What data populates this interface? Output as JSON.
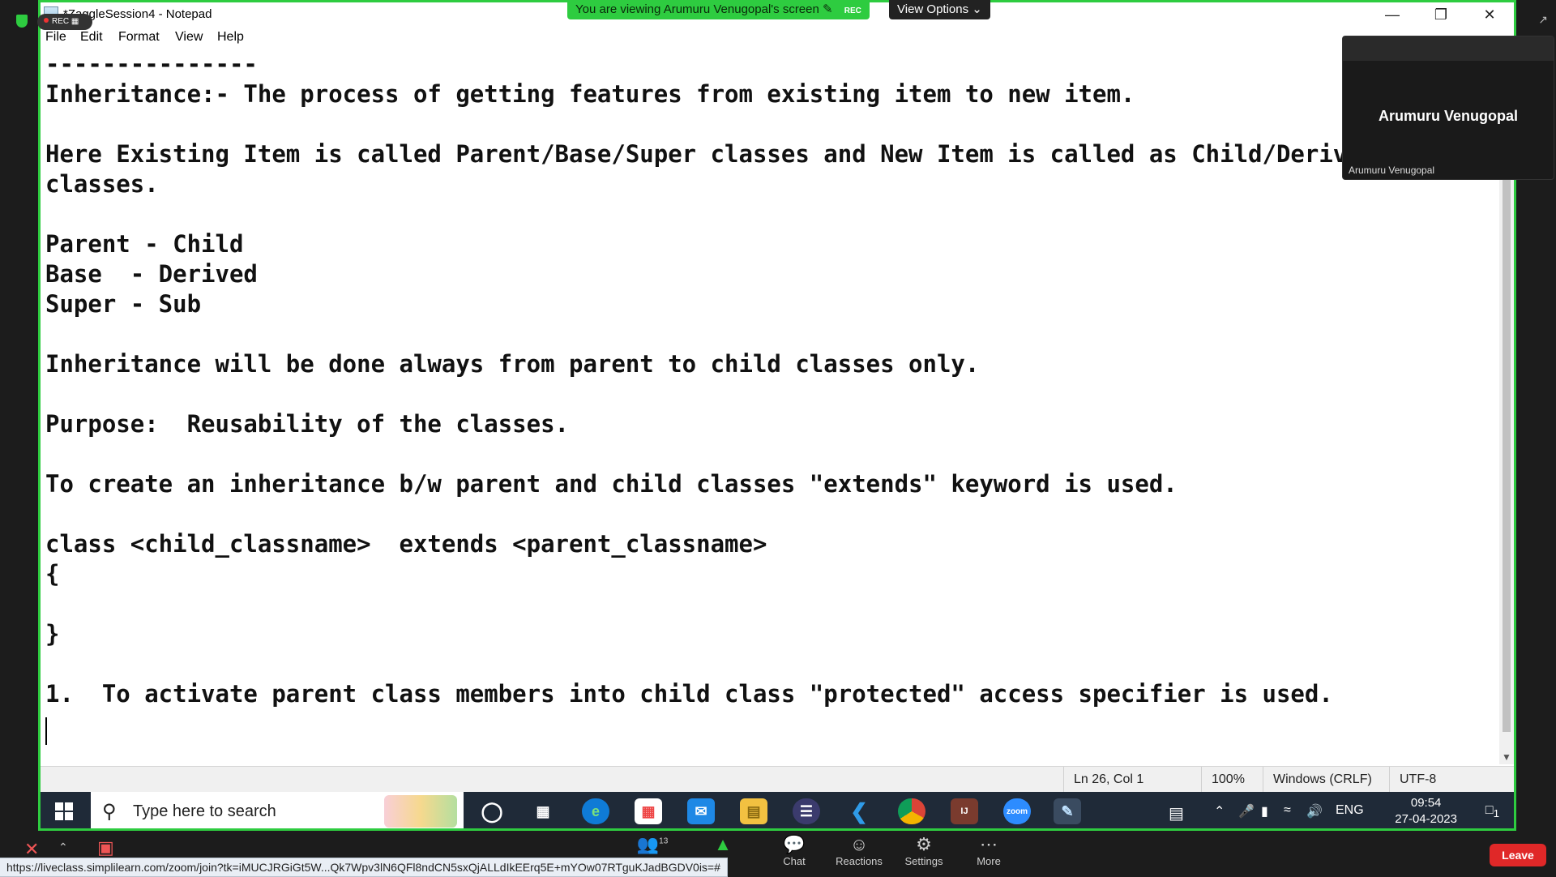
{
  "notepad": {
    "title": "*ZaggleSession4 - Notepad",
    "menu": [
      "File",
      "Edit",
      "Format",
      "View",
      "Help"
    ],
    "lines": [
      "---------------",
      "Inheritance:- The process of getting features from existing item to new item.",
      "",
      "Here Existing Item is called Parent/Base/Super classes and New Item is called as Child/Deriv",
      "classes.",
      "",
      "Parent - Child",
      "Base  - Derived",
      "Super - Sub",
      "",
      "Inheritance will be done always from parent to child classes only.",
      "",
      "Purpose:  Reusability of the classes.",
      "",
      "To create an inheritance b/w parent and child classes \"extends\" keyword is used.",
      "",
      "class <child_classname>  extends <parent_classname>",
      "{",
      "",
      "}",
      "",
      "1.  To activate parent class members into child class \"protected\" access specifier is used."
    ],
    "status": {
      "position": "Ln 26, Col 1",
      "zoom": "100%",
      "line_ending": "Windows (CRLF)",
      "encoding": "UTF-8"
    }
  },
  "taskbar": {
    "search_placeholder": "Type here to search",
    "tray_lang": "ENG",
    "time": "09:54",
    "date": "27-04-2023",
    "notification_count": "1"
  },
  "zoom": {
    "viewing_banner": "You are viewing Arumuru Venugopal's screen",
    "rec_label": "REC",
    "view_options": "View Options",
    "presenter_name": "Arumuru Venugopal",
    "presenter_label": "Arumuru Venugopal",
    "participants_count": "13",
    "controls": [
      "Chat",
      "Reactions",
      "Settings",
      "More"
    ],
    "leave": "Leave",
    "url": "https://liveclass.simplilearn.com/zoom/join?tk=iMUCJRGiGt5W...Qk7Wpv3lN6QFl8ndCN5sxQjALLdIkEErq5E+mYOw07RTguKJadBGDV0is=#"
  },
  "colors": {
    "share_border": "#2ecc40",
    "leave": "#e02828",
    "taskbar": "#1f2a38"
  }
}
